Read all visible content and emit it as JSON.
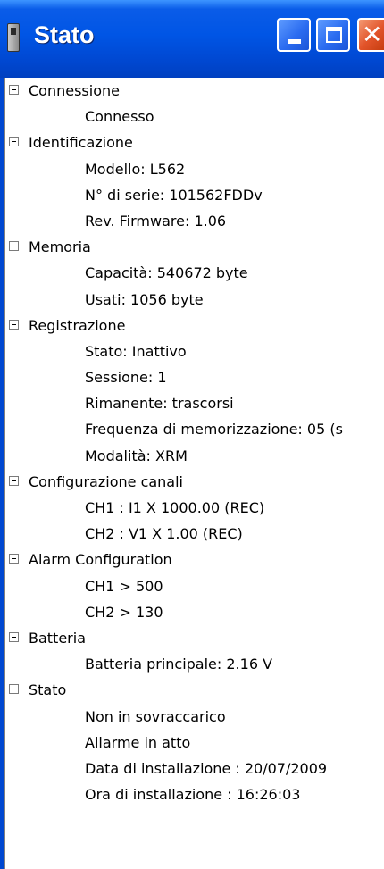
{
  "window": {
    "title": "Stato",
    "buttons": {
      "minimize_icon": "minimize-icon",
      "maximize_icon": "maximize-icon",
      "close_icon": "close-icon"
    }
  },
  "tree": [
    {
      "label": "Connessione",
      "children": [
        "Connesso"
      ]
    },
    {
      "label": "Identificazione",
      "children": [
        "Modello: L562",
        "N° di serie: 101562FDDv",
        "Rev. Firmware: 1.06"
      ]
    },
    {
      "label": "Memoria",
      "children": [
        "Capacità: 540672 byte",
        "Usati: 1056 byte"
      ]
    },
    {
      "label": "Registrazione",
      "children": [
        "Stato: Inattivo",
        "Sessione: 1",
        "Rimanente: trascorsi",
        "Frequenza di memorizzazione: 05 (s",
        "Modalità: XRM"
      ]
    },
    {
      "label": "Configurazione canali",
      "children": [
        "CH1 :  I1 X 1000.00 (REC)",
        "CH2 :  V1 X 1.00 (REC)"
      ]
    },
    {
      "label": "Alarm Configuration",
      "children": [
        "CH1 > 500",
        "CH2 > 130"
      ]
    },
    {
      "label": "Batteria",
      "children": [
        "Batteria principale: 2.16 V"
      ]
    },
    {
      "label": "Stato",
      "children": [
        "Non in sovraccarico",
        "Allarme in atto",
        "Data di installazione : 20/07/2009",
        "Ora di installazione : 16:26:03"
      ]
    }
  ]
}
